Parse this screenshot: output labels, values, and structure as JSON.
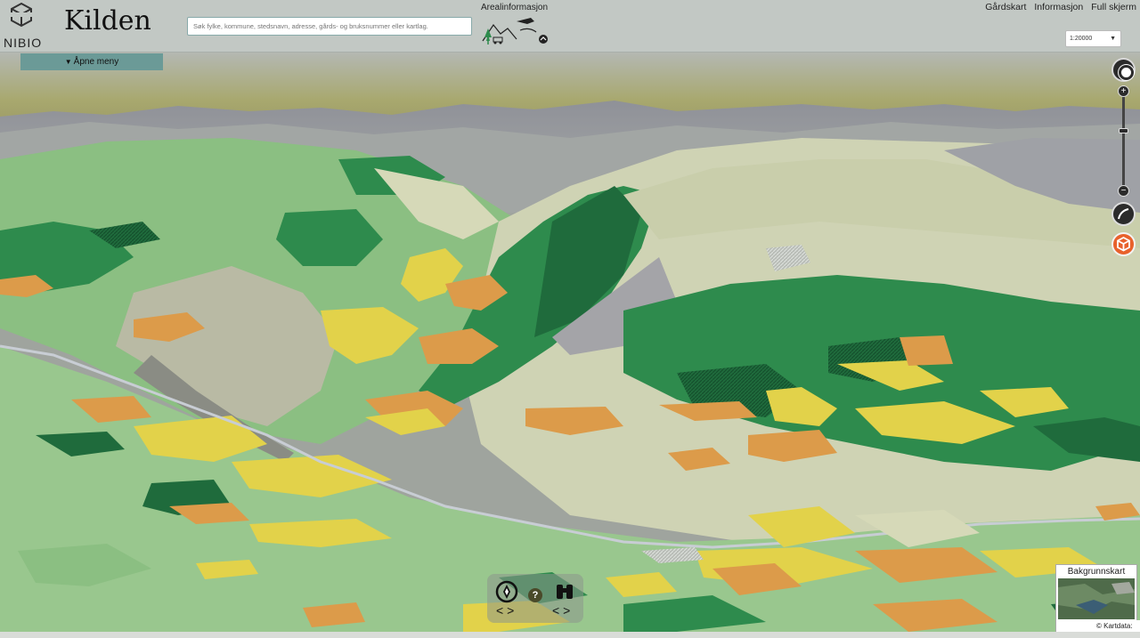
{
  "header": {
    "logo_text": "NIBIO",
    "app_title": "Kilden",
    "search_placeholder": "Søk fylke, kommune, stedsnavn, adresse, gårds- og bruksnummer eller kartlag.",
    "arealinfo_label": "Arealinformasjon",
    "nav": [
      "Gårdskart",
      "Informasjon",
      "Full skjerm"
    ],
    "scale_value": "1:20000"
  },
  "menu": {
    "open_label": "Åpne meny",
    "arrow_icon": "triangle-down-icon"
  },
  "tools": {
    "compass_icon": "compass-icon",
    "zoom_in": "+",
    "zoom_out": "−",
    "path_icon": "flight-path-icon",
    "box_icon": "3d-box-icon",
    "box_color": "#e8612c"
  },
  "nav_controls": {
    "help": "?",
    "left_glyph": "< >",
    "right_glyph": "< >"
  },
  "basemap": {
    "label": "Bakgrunnskart",
    "attribution": "© Kartdata:"
  },
  "colors": {
    "forest_dark": "#1f6b3c",
    "forest": "#2e8b4d",
    "meadow": "#8bbf82",
    "bare": "#d6d9b8",
    "yellow": "#e2d24a",
    "orange": "#dc9b4a",
    "rock": "#a4a4a8"
  }
}
